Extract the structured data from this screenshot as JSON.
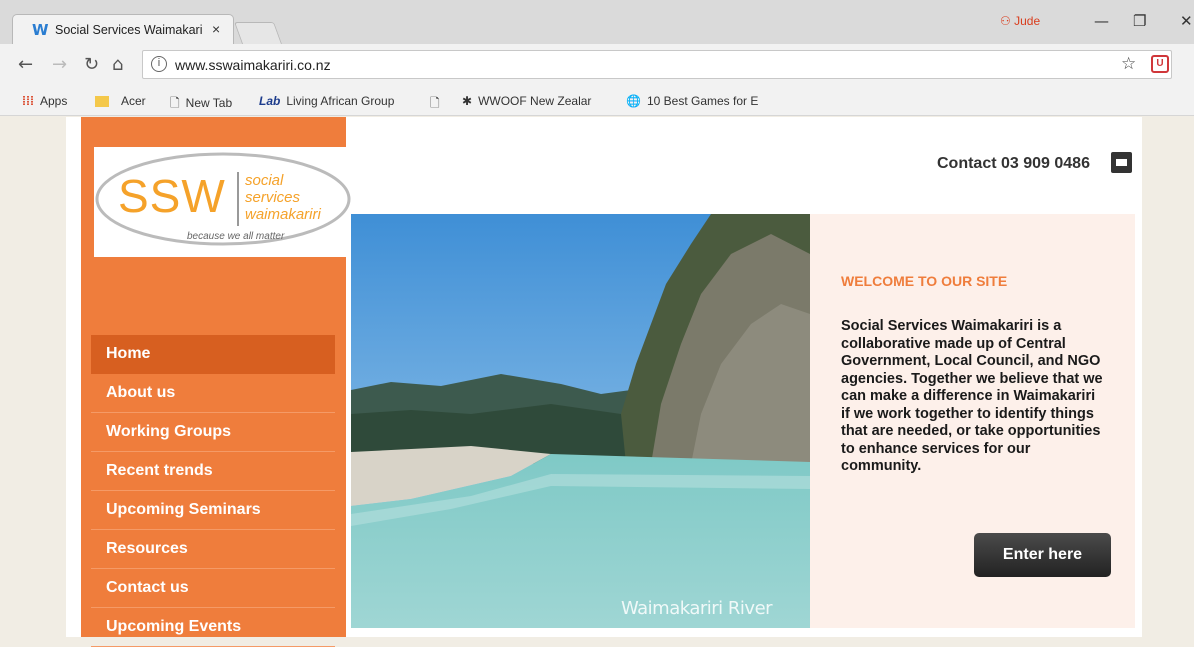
{
  "browser": {
    "tab_title": "Social Services Waimakariri",
    "tab_close": "×",
    "profile_name": "Jude",
    "url": "www.sswaimakariri.co.nz",
    "bookmarks": [
      {
        "label": "Apps",
        "icon": "apps-grid-icon"
      },
      {
        "label": "Acer",
        "icon": "folder-icon"
      },
      {
        "label": "New Tab",
        "icon": "page-icon"
      },
      {
        "label": "Living African Group",
        "icon": "lab-icon"
      },
      {
        "label": "",
        "icon": "page-icon"
      },
      {
        "label": "WWOOF New Zealar",
        "icon": "wwoof-icon"
      },
      {
        "label": "10 Best Games for E",
        "icon": "globe-icon"
      }
    ]
  },
  "site": {
    "logo": {
      "abbr": "SSW",
      "words": [
        "social",
        "services",
        "waimakariri"
      ],
      "tagline": "because we all matter"
    },
    "contact": "Contact 03 909 0486",
    "menu": [
      {
        "label": "Home",
        "active": true
      },
      {
        "label": "About us"
      },
      {
        "label": "Working Groups"
      },
      {
        "label": "Recent trends"
      },
      {
        "label": "Upcoming Seminars"
      },
      {
        "label": "Resources"
      },
      {
        "label": "Contact us"
      },
      {
        "label": "Upcoming Events"
      }
    ],
    "hero_caption": "Waimakariri River",
    "welcome": {
      "title": "WELCOME TO OUR SITE",
      "body": "Social Services Waimakariri is a collaborative made up of Central Government, Local Council, and NGO agencies.  Together we believe that we can make a difference in Waimakariri if we work together to identify things that are needed, or take opportunities to enhance services for our community.",
      "button": "Enter here"
    }
  },
  "colors": {
    "sidebar": "#ef7d3c",
    "menu_active": "#d75f20",
    "accent": "#ef7d3c",
    "panel": "#fdf0ea"
  }
}
